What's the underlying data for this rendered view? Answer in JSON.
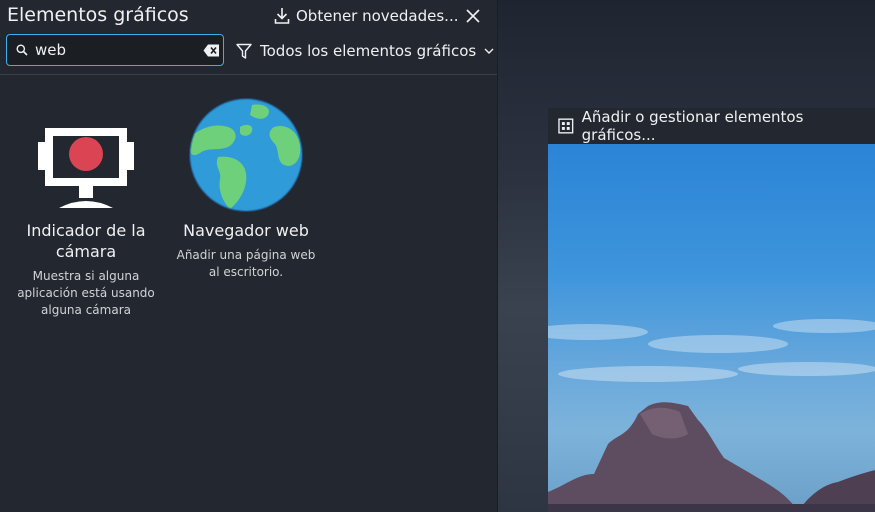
{
  "panel": {
    "title": "Elementos gráficos",
    "get_new_label": "Obtener novedades...",
    "search": {
      "value": "web"
    },
    "filter_label": "Todos los elementos gráficos"
  },
  "widgets": [
    {
      "name": "Indicador de la cámara",
      "description": "Muestra si alguna aplicación está usando alguna cámara"
    },
    {
      "name": "Navegador web",
      "description": "Añadir una página web al escritorio."
    }
  ],
  "window": {
    "title": "Añadir o gestionar elementos gráficos..."
  },
  "colors": {
    "accent": "#3daee9",
    "panel_bg": "#232830",
    "camera_red": "#da4453"
  }
}
